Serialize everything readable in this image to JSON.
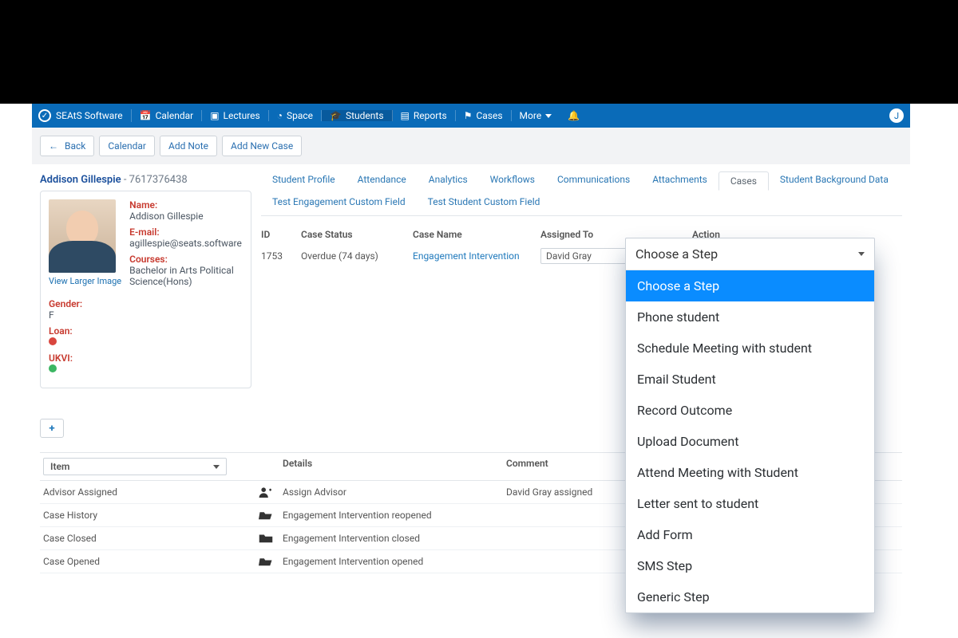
{
  "brand": {
    "name": "SEAtS Software"
  },
  "nav": {
    "items": [
      {
        "label": "Calendar"
      },
      {
        "label": "Lectures"
      },
      {
        "label": "Space"
      },
      {
        "label": "Students"
      },
      {
        "label": "Reports"
      },
      {
        "label": "Cases"
      },
      {
        "label": "More"
      }
    ],
    "user_initial": "J"
  },
  "toolbar": {
    "back": "Back",
    "calendar": "Calendar",
    "add_note": "Add Note",
    "add_case": "Add New Case"
  },
  "profile": {
    "heading_name": "Addison Gillespie",
    "heading_id": " - 7617376438",
    "view_larger": "View Larger Image",
    "name_label": "Name:",
    "name_value": "Addison Gillespie",
    "email_label": "E-mail:",
    "email_value": "agillespie@seats.software",
    "courses_label": "Courses:",
    "courses_value": "Bachelor in Arts Political Science(Hons)",
    "gender_label": "Gender:",
    "gender_value": "F",
    "loan_label": "Loan:",
    "ukvi_label": "UKVI:"
  },
  "tabs": [
    {
      "label": "Student Profile"
    },
    {
      "label": "Attendance"
    },
    {
      "label": "Analytics"
    },
    {
      "label": "Workflows"
    },
    {
      "label": "Communications"
    },
    {
      "label": "Attachments"
    },
    {
      "label": "Cases",
      "active": true
    },
    {
      "label": "Student Background Data"
    },
    {
      "label": "Test Engagement Custom Field"
    },
    {
      "label": "Test Student Custom Field"
    }
  ],
  "cases_table": {
    "headers": {
      "id": "ID",
      "status": "Case Status",
      "name": "Case Name",
      "assigned": "Assigned To",
      "action": "Action"
    },
    "row": {
      "id": "1753",
      "status": "Overdue (74 days)",
      "name": "Engagement Intervention",
      "assigned": "David Gray"
    }
  },
  "details": {
    "headers": {
      "item": "Item",
      "details": "Details",
      "comment": "Comment"
    },
    "item_selected": "Item",
    "rows": [
      {
        "item": "Advisor Assigned",
        "icon": "user-plus",
        "details": "Assign Advisor",
        "comment": "David Gray assigned"
      },
      {
        "item": "Case History",
        "icon": "folder-open",
        "details": "Engagement Intervention reopened",
        "comment": ""
      },
      {
        "item": "Case Closed",
        "icon": "folder-closed",
        "details": "Engagement Intervention closed",
        "comment": ""
      },
      {
        "item": "Case Opened",
        "icon": "folder-open",
        "details": "Engagement Intervention opened",
        "comment": ""
      }
    ]
  },
  "action_dropdown": {
    "selected": "Choose a Step",
    "options": [
      "Choose a Step",
      "Phone student",
      "Schedule Meeting with student",
      "Email Student",
      "Record Outcome",
      "Upload Document",
      "Attend Meeting with Student",
      "Letter sent to student",
      "Add Form",
      "SMS Step",
      "Generic Step"
    ]
  }
}
